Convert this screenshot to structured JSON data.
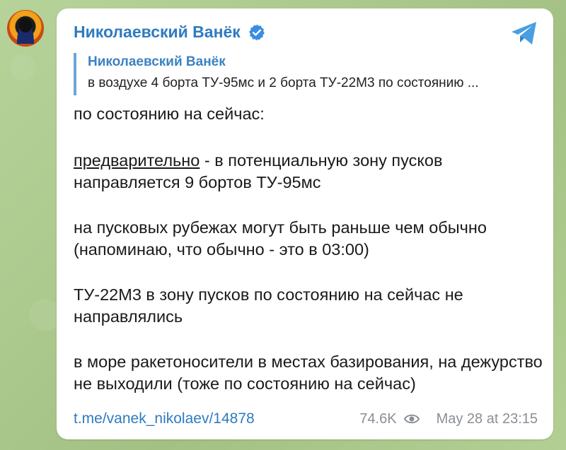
{
  "channel": {
    "name": "Николаевский Ванёк",
    "verified_icon": "verified-badge-icon",
    "app_icon": "telegram-icon"
  },
  "reply": {
    "name": "Николаевский Ванёк",
    "text": "в воздухе 4 борта ТУ-95мс и 2 борта ТУ-22М3 по состоянию ..."
  },
  "message": {
    "line1": "по состоянию на сейчас:",
    "para2_underlined": "предварительно",
    "para2_rest": " - в потенциальную зону пусков направляется 9 бортов ТУ-95мс",
    "para3": "на пусковых рубежах могут быть раньше чем обычно (напоминаю, что обычно - это в 03:00)",
    "para4": "ТУ-22М3 в зону пусков по состоянию на сейчас не направлялись",
    "para5": "в море ракетоносители в местах базирования, на дежурство не выходили (тоже по состоянию на сейчас)"
  },
  "footer": {
    "link": "t.me/vanek_nikolaev/14878",
    "views": "74.6K",
    "views_icon": "eye-icon",
    "time": "May 28 at 23:15"
  },
  "colors": {
    "accent": "#2f7bc0",
    "background": "#a9c58f",
    "bubble": "#ffffff",
    "meta": "#8a8f95"
  }
}
